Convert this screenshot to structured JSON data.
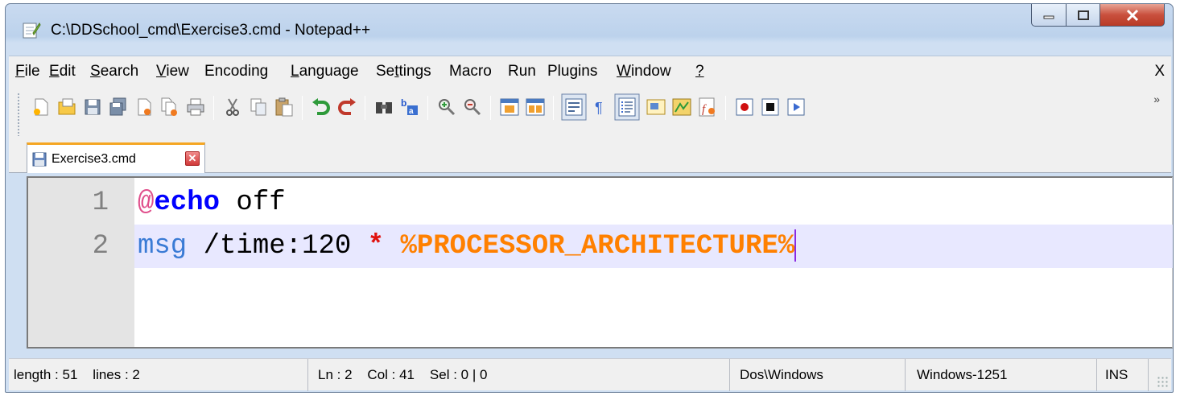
{
  "window": {
    "title": "C:\\DDSchool_cmd\\Exercise3.cmd - Notepad++"
  },
  "menubar": {
    "items": [
      "File",
      "Edit",
      "Search",
      "View",
      "Encoding",
      "Language",
      "Settings",
      "Macro",
      "Run",
      "Plugins",
      "Window",
      "?"
    ],
    "close_label": "X"
  },
  "toolbar": {
    "icons": [
      "new-file-icon",
      "open-file-icon",
      "save-icon",
      "save-all-icon",
      "close-icon",
      "close-all-icon",
      "print-icon",
      "cut-icon",
      "copy-icon",
      "paste-icon",
      "undo-icon",
      "redo-icon",
      "find-icon",
      "replace-icon",
      "zoom-in-icon",
      "zoom-out-icon",
      "sync-vertical-icon",
      "sync-horizontal-icon",
      "word-wrap-icon",
      "show-all-chars-icon",
      "indent-guide-icon",
      "user-defined-language-icon",
      "doc-map-icon",
      "function-list-icon",
      "record-macro-icon",
      "stop-macro-icon",
      "play-macro-icon"
    ],
    "more_label": "»"
  },
  "tabs": [
    {
      "label": "Exercise3.cmd",
      "close_label": "✕"
    }
  ],
  "editor": {
    "lines": [
      {
        "number": "1",
        "tokens": {
          "at": "@",
          "kw": "echo",
          "rest": " off"
        }
      },
      {
        "number": "2",
        "tokens": {
          "cmd": "msg",
          "plain": " /time:120 ",
          "op": "*",
          "space": " ",
          "var": "%PROCESSOR_ARCHITECTURE%"
        }
      }
    ]
  },
  "statusbar": {
    "length": "length : 51    lines : 2",
    "position": "Ln : 2    Col : 41    Sel : 0 | 0",
    "eol": "Dos\\Windows",
    "encoding": "Windows-1251",
    "mode": "INS"
  },
  "colors": {
    "tab_accent": "#f5a623",
    "current_line": "#e8e8ff",
    "keyword": "#0000ff",
    "variable": "#ff8000",
    "operator": "#e0120f"
  }
}
